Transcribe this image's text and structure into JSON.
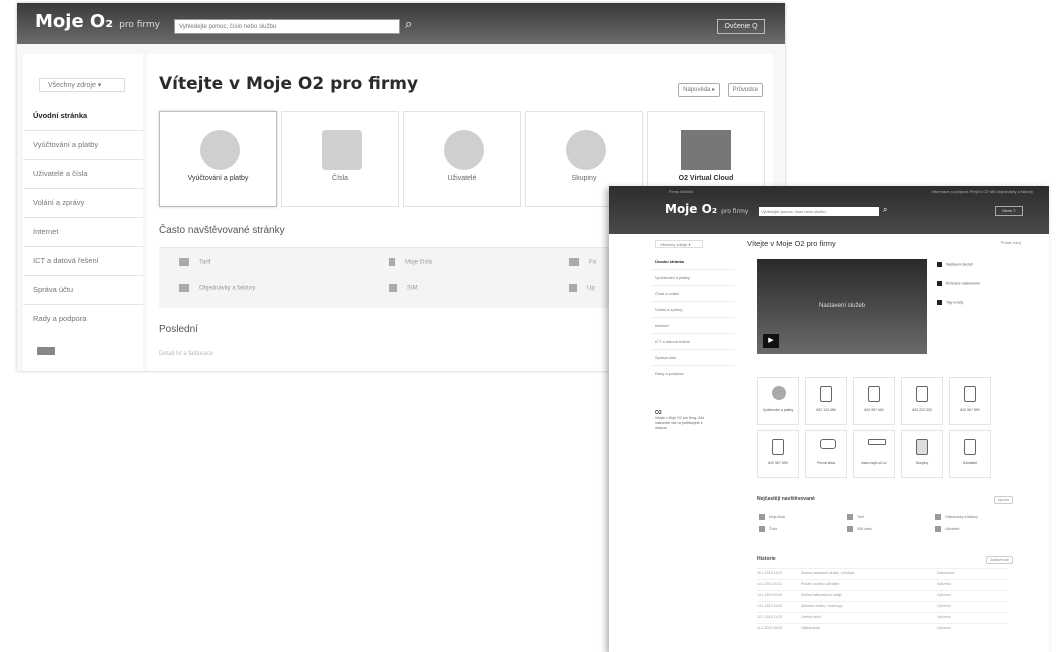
{
  "screen1": {
    "header": {
      "logo": "Moje O₂",
      "logo_sub": "pro firmy",
      "search_placeholder": "Vyhledejte pomoc, číslo nebo službu",
      "button": "Ovčenie Q"
    },
    "sidebar": {
      "context": "Všechny zdroje ▾",
      "items": [
        {
          "label": "Úvodní stránka"
        },
        {
          "label": "Vyúčtování a platby"
        },
        {
          "label": "Uživatelé a čísla"
        },
        {
          "label": "Volání a zprávy"
        },
        {
          "label": "Internet"
        },
        {
          "label": "ICT a datová řešení"
        },
        {
          "label": "Správa účtu"
        },
        {
          "label": "Rady a podpora"
        }
      ]
    },
    "main": {
      "title": "Vítejte v Moje O2 pro firmy",
      "top_buttons": [
        "Nápověda ▸",
        "Průvodce"
      ],
      "tiles": [
        {
          "label": "Vyúčtování a platby"
        },
        {
          "label": "Čísla"
        },
        {
          "label": "Uživatelé"
        },
        {
          "label": "Skupiny"
        },
        {
          "label": "O2 Virtual Cloud"
        }
      ],
      "frequent_title": "Často navštěvované stránky",
      "frequent_links": [
        "Tarif",
        "Moje čísla",
        "Fa",
        "Objednávky a faktury",
        "SIM",
        "Up"
      ],
      "history_title": "Poslední",
      "history_faint": "Detail lvl a fakturace"
    }
  },
  "screen2": {
    "header": {
      "top_links": "Firmy   Mobilní",
      "top_right": "Informace a podpora   Přejít k O2   Mé objednávky a faktury",
      "logo": "Moje O₂",
      "logo_sub": "pro firmy",
      "search_placeholder": "Vyhledejte pomoc, číslo nebo službu",
      "button": "Menu ≡"
    },
    "sidebar": {
      "context": "Všechny zdroje ▾",
      "items": [
        {
          "label": "Úvodní stránka"
        },
        {
          "label": "Vyúčtování a platby"
        },
        {
          "label": "Čísla a volání"
        },
        {
          "label": "Volání a zprávy"
        },
        {
          "label": "Internet"
        },
        {
          "label": "ICT a datová řešení"
        },
        {
          "label": "Správa účtu"
        },
        {
          "label": "Rady a podpora"
        }
      ],
      "box_title": "O2",
      "box_text": "Vítejte v Moje O2 pro firmy. Zde naleznete vše co potřebujete k obsluze"
    },
    "main": {
      "title": "Vítejte v Moje O2 pro firmy",
      "title_link": "Přidat zdroj",
      "video_title": "Nastavení služeb",
      "video_links": [
        "Nastavení služeb",
        "Průvodce nastavením",
        "Tipy a rady"
      ],
      "tiles_row1": [
        {
          "label": "Vyúčtování a platby"
        },
        {
          "label": "602 123 456"
        },
        {
          "label": "602 987 654"
        },
        {
          "label": "603 222 333"
        },
        {
          "label": "602 567 890"
        }
      ],
      "tiles_row2": [
        {
          "label": "602 567 890"
        },
        {
          "label": "Pevná linka"
        },
        {
          "label": "www.moje-o2.cz"
        },
        {
          "label": "Skupiny"
        },
        {
          "label": "Uživatelé"
        }
      ],
      "frequent_title": "Nejčastěji navštěvované",
      "frequent_more": "Upravit",
      "frequent_links": [
        "Moje čísla",
        "Tarif",
        "Objednávky a faktury",
        "Čísla",
        "SIM karty",
        "Uživatelé"
      ],
      "history_title": "Historie",
      "history_more": "Zobrazit vše",
      "history": [
        {
          "date": "15.1.2013 13:01",
          "text": "Změna nastavení služby / přístupu",
          "status": "Dokončeno"
        },
        {
          "date": "14.1.2013 10:11",
          "text": "Přidání nového uživatele",
          "status": "Vyřízeno"
        },
        {
          "date": "14.1.2013 09:43",
          "text": "Změna fakturačních údajů",
          "status": "Vyřízeno"
        },
        {
          "date": "13.1.2013 16:52",
          "text": "Aktivace služby / roamingu",
          "status": "Vyřízeno"
        },
        {
          "date": "12.1.2013 11:20",
          "text": "Změna tarifu",
          "status": "Vyřízeno"
        },
        {
          "date": "11.1.2013 08:05",
          "text": "Objednávka",
          "status": "Vyřízeno"
        }
      ]
    }
  }
}
